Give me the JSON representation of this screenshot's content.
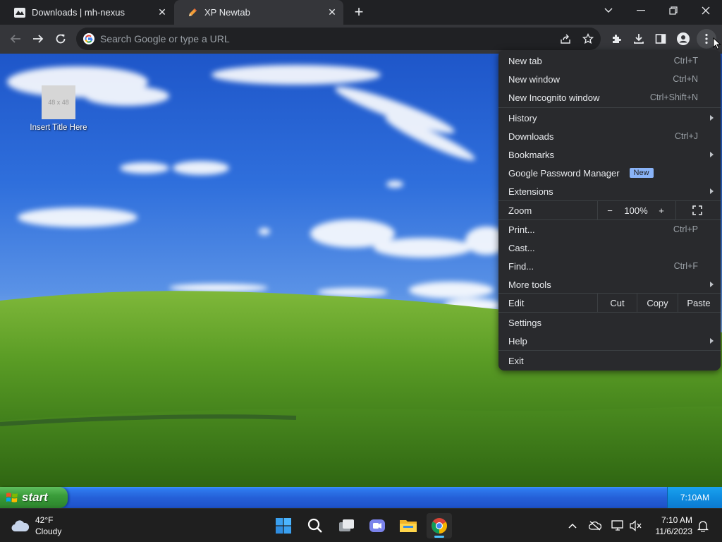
{
  "browser": {
    "tabs": [
      {
        "title": "Downloads | mh-nexus",
        "favicon": "mh-nexus-icon",
        "active": false
      },
      {
        "title": "XP Newtab",
        "favicon": "pencil-icon",
        "active": true
      }
    ],
    "omnibox": {
      "placeholder": "Search Google or type a URL",
      "value": ""
    }
  },
  "desktop": {
    "icon": {
      "placeholder_text": "48 x 48",
      "label": "Insert Title Here"
    }
  },
  "xp_taskbar": {
    "start_label": "start",
    "clock": "7:10AM"
  },
  "menu": {
    "new_tab": {
      "label": "New tab",
      "shortcut": "Ctrl+T"
    },
    "new_window": {
      "label": "New window",
      "shortcut": "Ctrl+N"
    },
    "new_incognito": {
      "label": "New Incognito window",
      "shortcut": "Ctrl+Shift+N"
    },
    "history": {
      "label": "History"
    },
    "downloads": {
      "label": "Downloads",
      "shortcut": "Ctrl+J"
    },
    "bookmarks": {
      "label": "Bookmarks"
    },
    "password_manager": {
      "label": "Google Password Manager",
      "badge": "New"
    },
    "extensions": {
      "label": "Extensions"
    },
    "zoom": {
      "label": "Zoom",
      "minus": "−",
      "value": "100%",
      "plus": "+"
    },
    "print": {
      "label": "Print...",
      "shortcut": "Ctrl+P"
    },
    "cast": {
      "label": "Cast..."
    },
    "find": {
      "label": "Find...",
      "shortcut": "Ctrl+F"
    },
    "more_tools": {
      "label": "More tools"
    },
    "edit": {
      "label": "Edit",
      "cut": "Cut",
      "copy": "Copy",
      "paste": "Paste"
    },
    "settings": {
      "label": "Settings"
    },
    "help": {
      "label": "Help"
    },
    "exit": {
      "label": "Exit"
    }
  },
  "win11_taskbar": {
    "weather": {
      "temp": "42°F",
      "condition": "Cloudy"
    },
    "clock": {
      "time": "7:10 AM",
      "date": "11/6/2023"
    }
  },
  "colors": {
    "chrome_dark": "#202124",
    "toolbar": "#35363a",
    "menu_bg": "#292a2d",
    "badge": "#8ab4f8",
    "xp_blue": "#2560d8",
    "xp_start_green": "#3a9d3a",
    "w11_accent": "#4cc2ff"
  }
}
